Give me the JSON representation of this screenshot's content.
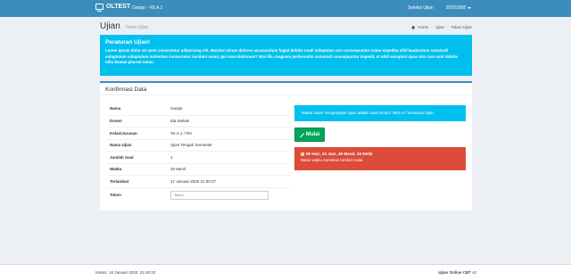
{
  "topbar": {
    "brand": "OLTEST",
    "user_class": "Ganjar - XII.A.1",
    "menu": [
      "Seleksi Ujian",
      "20201008"
    ]
  },
  "page": {
    "title": "Ujian",
    "subtitle": "Token Ujian",
    "breadcrumb": [
      "Home",
      "Ujian",
      "Token Ujian"
    ]
  },
  "rules": {
    "title": "Peraturan Ujian!",
    "text": "Lorem ipsum dolor sit amet consectetur adipisicing elit. Maxime minus dolores accusantium fugiat debitis modi voluptates non consequuntur nemo expedita nihil laudantium commodi voluptatum voluptatem molestiae consectetur incidunt animi, qui exercitationem? Nisi illo, magnam perferendis commodi consequuntur impedit, et nihil excepturi quas iste cum sunt debitis odio beatae placeat nemo."
  },
  "confirm": {
    "header": "Konfirmasi Data",
    "rows": [
      {
        "label": "Nama",
        "value": "Ganjar"
      },
      {
        "label": "Dosen",
        "value": "Ida Setiani"
      },
      {
        "label": "Kelas/Jurusan",
        "value": "XII.A.1 / IPA"
      },
      {
        "label": "Nama Ujian",
        "value": "Ujian Tengah Semester"
      },
      {
        "label": "Jumlah Soal",
        "value": "1"
      },
      {
        "label": "Waktu",
        "value": "30 Menit"
      },
      {
        "label": "Terlambat",
        "value": "17 Januari 2020 21:30:27"
      }
    ],
    "token_label": "Token",
    "token_placeholder": "Token"
  },
  "panel": {
    "note": "Waktu boleh mengerjakan ujian adalah saat tombol \"MULAI\" berwarna hijau.",
    "start_label": "Mulai",
    "countdown": "00 Hari, 23 Jam, 49 Menit, 34 Detik",
    "countdown_note": "Batas waktu menekan tombol mulai."
  },
  "footer": {
    "datetime": "Kamis, 16 Januari 2020, 21:45:22",
    "app_name": "Ujian Online CBT",
    "version": "v2"
  },
  "colors": {
    "header": "#3c8dbc",
    "info": "#00c0ef",
    "success": "#00a65a",
    "danger": "#dd4b39",
    "background": "#ecf0f5"
  }
}
